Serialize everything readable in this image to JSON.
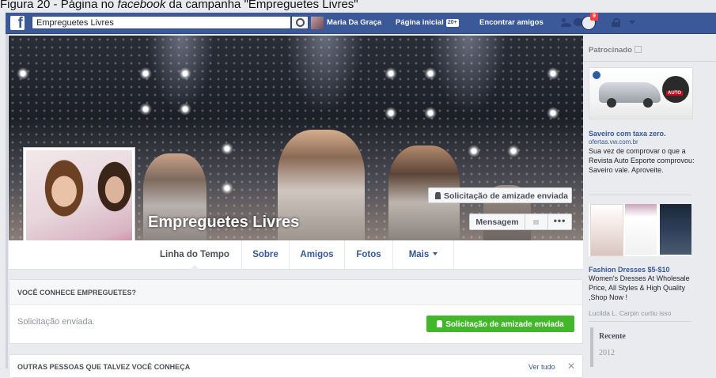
{
  "caption": {
    "prefix": "Figura 20 - Página no ",
    "italic": "facebook",
    "suffix": " da campanha \"Empreguetes Livres\""
  },
  "topbar": {
    "logo": "f",
    "search_value": "Empreguetes Livres",
    "user_name": "Maria Da Graça",
    "home_label": "Página inicial",
    "home_badge": "20+",
    "find_friends_label": "Encontrar amigos",
    "notification_count": "9"
  },
  "profile": {
    "name": "Empreguetes Livres",
    "friend_request_label": "Solicitação de amizade enviada",
    "message_label": "Mensagem",
    "more_label": "•••"
  },
  "tabs": [
    {
      "label": "Linha do Tempo"
    },
    {
      "label": "Sobre"
    },
    {
      "label": "Amigos"
    },
    {
      "label": "Fotos"
    },
    {
      "label": "Mais"
    }
  ],
  "know_card": {
    "header": "VOCÊ CONHECE EMPREGUETES?",
    "status_text": "Solicitação enviada.",
    "button_label": "Solicitação de amizade enviada"
  },
  "people_card": {
    "header": "OUTRAS PESSOAS QUE TALVEZ VOCÊ CONHEÇA",
    "see_all": "Ver tudo",
    "close": "✕"
  },
  "right_column": {
    "sponsored_label": "Patrocinado",
    "ad1": {
      "title": "Saveiro com taxa zero.",
      "url": "ofertas.vw.com.br",
      "body": "Sua vez de comprovar o que a Revista Auto Esporte comprovou: Saveiro vale. Aproveite."
    },
    "ad2": {
      "title": "Fashion Dresses $5-$10",
      "body": "Women's Dresses At Wholesale Price, All Styles & High Quality ,Shop Now !",
      "liked_by": "Lucilda L. Carpin curtiu isso"
    },
    "timeline_recent": "Recente",
    "timeline_year": "2012"
  },
  "colors": {
    "fb_blue": "#3b5998",
    "link_blue": "#365899",
    "green": "#42b72a",
    "page_bg": "#e9ebee"
  }
}
